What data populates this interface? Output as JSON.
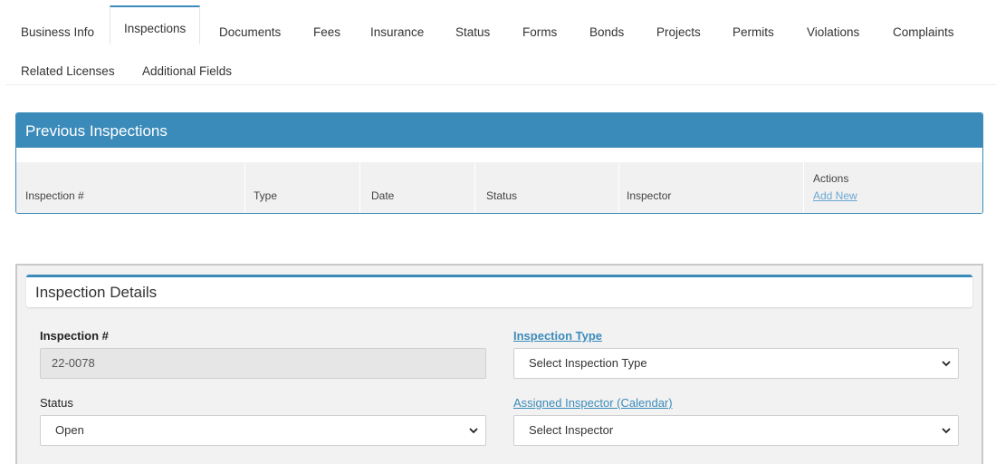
{
  "tabs": [
    {
      "label": "Business Info"
    },
    {
      "label": "Inspections",
      "active": true
    },
    {
      "label": "Documents"
    },
    {
      "label": "Fees"
    },
    {
      "label": "Insurance"
    },
    {
      "label": "Status"
    },
    {
      "label": "Forms"
    },
    {
      "label": "Bonds"
    },
    {
      "label": "Projects"
    },
    {
      "label": "Permits"
    },
    {
      "label": "Violations"
    },
    {
      "label": "Complaints"
    },
    {
      "label": "Related Licenses"
    },
    {
      "label": "Additional Fields"
    }
  ],
  "previous_inspections": {
    "title": "Previous Inspections",
    "columns": {
      "inspection_num": "Inspection #",
      "type": "Type",
      "date": "Date",
      "status": "Status",
      "inspector": "Inspector",
      "actions": "Actions"
    },
    "add_new_label": "Add New"
  },
  "details": {
    "title": "Inspection Details",
    "inspection_num_label": "Inspection #",
    "inspection_num_value": "22-0078",
    "inspection_type_label": "Inspection Type",
    "inspection_type_value": "Select Inspection Type",
    "status_label": "Status",
    "status_value": "Open",
    "assigned_inspector_label": "Assigned Inspector (Calendar)",
    "assigned_inspector_value": "Select Inspector"
  },
  "colors": {
    "accent": "#3b8bba",
    "link_light": "#6aa8d3",
    "panel_bg": "#f2f2f2"
  }
}
